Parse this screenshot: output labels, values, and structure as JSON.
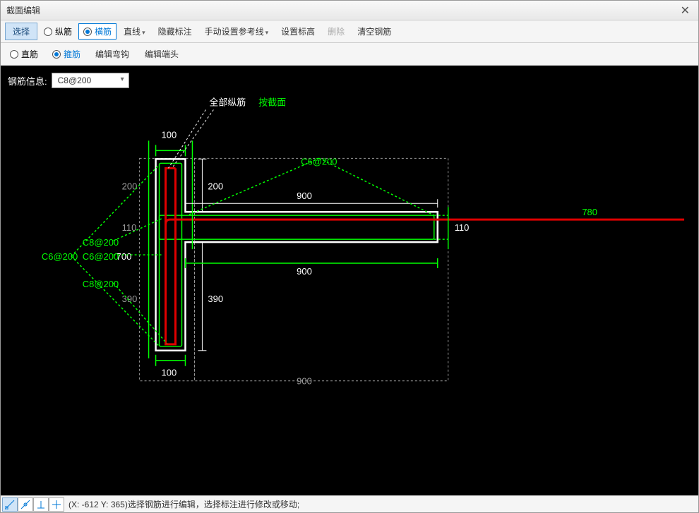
{
  "window": {
    "title": "截面编辑",
    "close": "✕"
  },
  "toolbar1": {
    "select": "选择",
    "radio1": "纵筋",
    "radio2": "横筋",
    "line": "直线",
    "hide": "隐藏标注",
    "ref": "手动设置参考线",
    "elev": "设置标高",
    "delete": "删除",
    "clear": "清空钢筋"
  },
  "toolbar2": {
    "radio1": "直筋",
    "radio2": "箍筋",
    "edit_hook": "编辑弯钩",
    "edit_end": "编辑端头"
  },
  "info": {
    "label": "钢筋信息:",
    "value": "C8@200"
  },
  "labels": {
    "legend_all": "全部纵筋",
    "legend_section": "按截面"
  },
  "dims": {
    "top_100": "100",
    "bottom_100": "100",
    "d200_white": "200",
    "d200_grey": "200",
    "d390_white": "390",
    "d390_grey": "390",
    "d700": "700",
    "d110_white": "110",
    "d110_grey": "110",
    "d900_top": "900",
    "d900_bot": "900",
    "d900_grey": "900",
    "d780": "780"
  },
  "codes": {
    "c6": "C6@200",
    "c6b": "C6@200",
    "c8a": "C8@200",
    "c8b": "C8@200"
  },
  "status": {
    "text": "(X: -612 Y: 365)选择钢筋进行编辑，选择标注进行修改或移动;"
  }
}
